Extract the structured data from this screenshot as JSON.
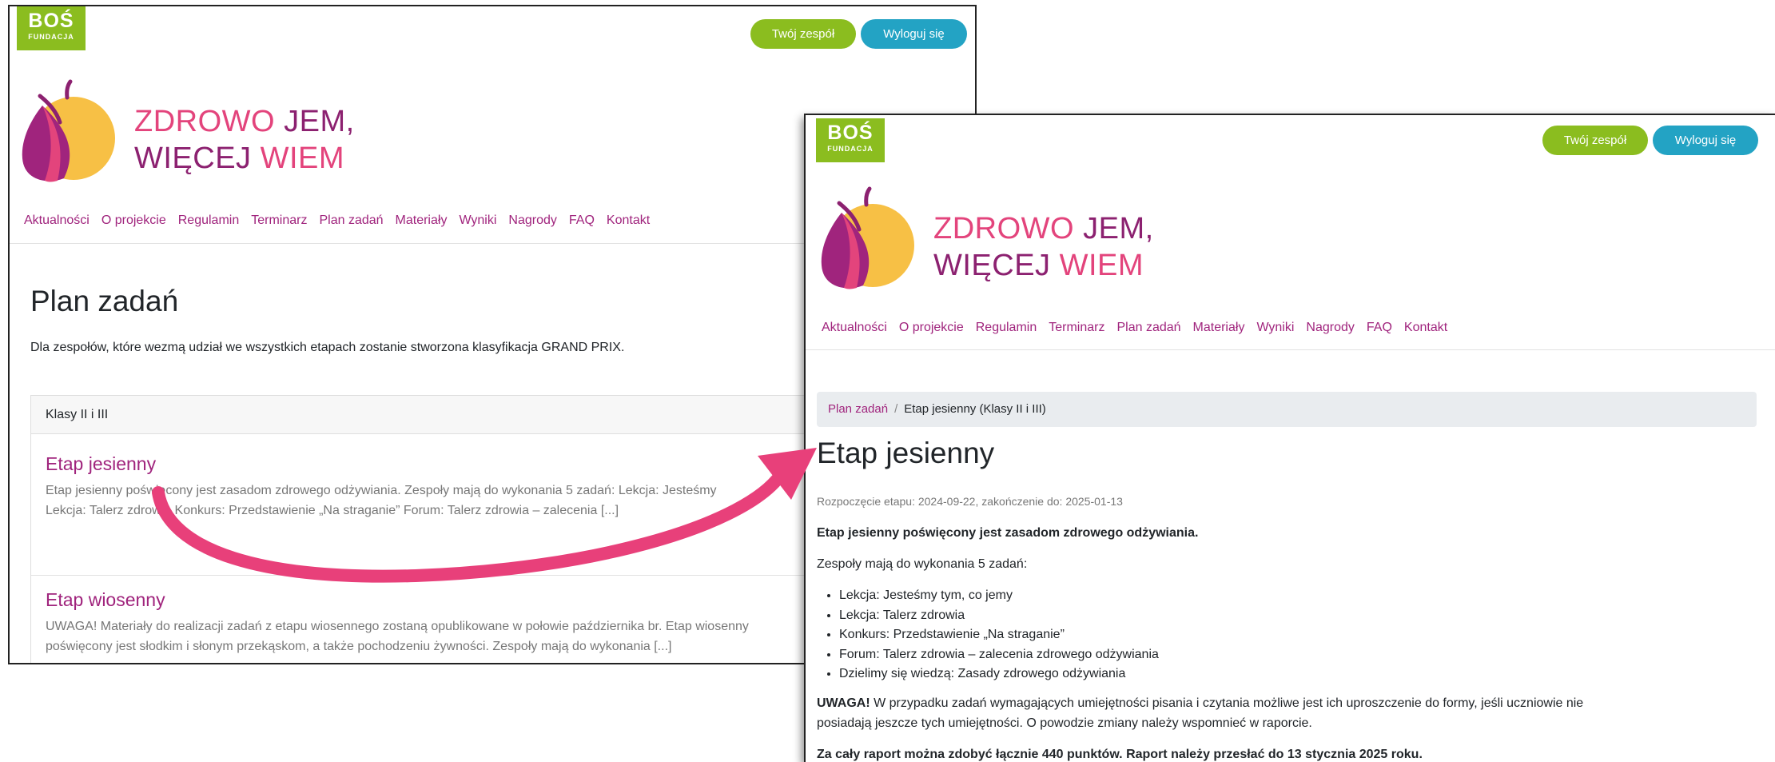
{
  "logo_bos": {
    "name": "BOŚ",
    "sub": "FUNDACJA"
  },
  "logo_title": {
    "line1_part1": "ZDROWO",
    "line1_part2": "JEM,",
    "line2_part1": "WIĘCEJ",
    "line2_part2": "WIEM"
  },
  "header_buttons": {
    "team": "Twój zespół",
    "logout": "Wyloguj się"
  },
  "nav": [
    "Aktualności",
    "O projekcie",
    "Regulamin",
    "Terminarz",
    "Plan zadań",
    "Materiały",
    "Wyniki",
    "Nagrody",
    "FAQ",
    "Kontakt"
  ],
  "plan_page": {
    "title": "Plan zadań",
    "intro": "Dla zespołów, które wezmą udział we wszystkich etapach zostanie stworzona klasyfikacja GRAND PRIX.",
    "card_header": "Klasy II i III",
    "items": [
      {
        "title": "Etap jesienny",
        "excerpt_line1": "Etap jesienny poświęcony jest zasadom zdrowego odżywiania. Zespoły mają do wykonania 5 zadań: Lekcja: Jesteśmy",
        "excerpt_line2": "Lekcja: Talerz zdrowia Konkurs: Przedstawienie „Na straganie” Forum: Talerz zdrowia – zalecenia [...]"
      },
      {
        "title": "Etap wiosenny",
        "excerpt_line1": "UWAGA! Materiały do realizacji zadań z etapu wiosennego zostaną opublikowane w połowie października br.  Etap wiosenny",
        "excerpt_line2": "poświęcony jest słodkim i słonym przekąskom, a także pochodzeniu żywności. Zespoły mają do wykonania [...]"
      }
    ]
  },
  "detail_page": {
    "breadcrumb": {
      "link": "Plan zadań",
      "separator": "/",
      "current": "Etap jesienny (Klasy II i III)"
    },
    "title": "Etap jesienny",
    "meta": "Rozpoczęcie etapu: 2024-09-22, zakończenie do: 2025-01-13",
    "lead": "Etap jesienny poświęcony jest zasadom zdrowego odżywiania.",
    "tasks_intro": "Zespoły mają do wykonania 5 zadań:",
    "tasks": [
      "Lekcja: Jesteśmy tym, co jemy",
      "Lekcja: Talerz zdrowia",
      "Konkurs: Przedstawienie „Na straganie”",
      "Forum: Talerz zdrowia – zalecenia zdrowego odżywiania",
      "Dzielimy się wiedzą: Zasady zdrowego odżywiania"
    ],
    "note_label": "UWAGA!",
    "note_line1": " W przypadku zadań wymagających umiejętności pisania i czytania możliwe jest ich uproszczenie do formy, jeśli uczniowie nie",
    "note_line2": "posiadają jeszcze tych umiejętności. O powodzie zmiany należy wspomnieć w raporcie.",
    "final": "Za cały raport można zdobyć łącznie 440 punktów. Raport należy przesłać do 13 stycznia 2025 roku."
  },
  "colors": {
    "accent_pink": "#e3447c",
    "accent_purple": "#8c2170",
    "green": "#8bbd1f",
    "blue": "#23a3c4",
    "arrow": "#e8407a"
  }
}
